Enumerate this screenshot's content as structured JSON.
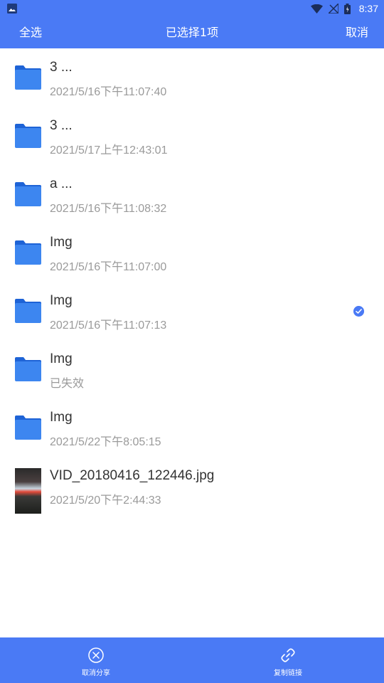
{
  "status_bar": {
    "time": "8:37",
    "icons": [
      "image-icon",
      "wifi-icon",
      "signal-icon",
      "battery-icon"
    ]
  },
  "app_bar": {
    "select_all": "全选",
    "title": "已选择1项",
    "cancel": "取消"
  },
  "files": [
    {
      "name": "3  ...",
      "date": "2021/5/16下午11:07:40",
      "type": "folder",
      "selected": false
    },
    {
      "name": "3  ...",
      "date": "2021/5/17上午12:43:01",
      "type": "folder",
      "selected": false
    },
    {
      "name": "a  ...",
      "date": "2021/5/16下午11:08:32",
      "type": "folder",
      "selected": false
    },
    {
      "name": "Img",
      "date": "2021/5/16下午11:07:00",
      "type": "folder",
      "selected": false
    },
    {
      "name": "Img",
      "date": "2021/5/16下午11:07:13",
      "type": "folder",
      "selected": true
    },
    {
      "name": "Img",
      "date": "已失效",
      "type": "folder",
      "selected": false
    },
    {
      "name": "Img",
      "date": "2021/5/22下午8:05:15",
      "type": "folder",
      "selected": false
    },
    {
      "name": "VID_20180416_122446.jpg",
      "date": "2021/5/20下午2:44:33",
      "type": "image",
      "selected": false
    }
  ],
  "bottom_bar": {
    "unshare": "取消分享",
    "copy_link": "复制链接"
  },
  "colors": {
    "accent": "#4a7af5",
    "folder_front": "#3d86f0",
    "folder_back": "#1e63d6"
  }
}
